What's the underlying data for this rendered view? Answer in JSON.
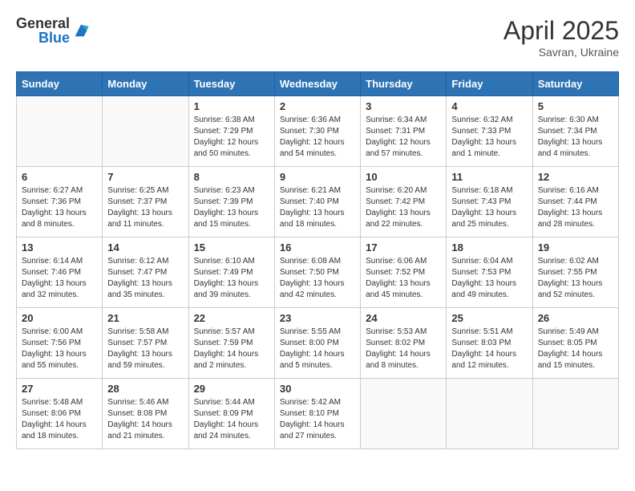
{
  "logo": {
    "general": "General",
    "blue": "Blue"
  },
  "title": "April 2025",
  "subtitle": "Savran, Ukraine",
  "days_of_week": [
    "Sunday",
    "Monday",
    "Tuesday",
    "Wednesday",
    "Thursday",
    "Friday",
    "Saturday"
  ],
  "weeks": [
    [
      {
        "day": "",
        "info": ""
      },
      {
        "day": "",
        "info": ""
      },
      {
        "day": "1",
        "info": "Sunrise: 6:38 AM\nSunset: 7:29 PM\nDaylight: 12 hours and 50 minutes."
      },
      {
        "day": "2",
        "info": "Sunrise: 6:36 AM\nSunset: 7:30 PM\nDaylight: 12 hours and 54 minutes."
      },
      {
        "day": "3",
        "info": "Sunrise: 6:34 AM\nSunset: 7:31 PM\nDaylight: 12 hours and 57 minutes."
      },
      {
        "day": "4",
        "info": "Sunrise: 6:32 AM\nSunset: 7:33 PM\nDaylight: 13 hours and 1 minute."
      },
      {
        "day": "5",
        "info": "Sunrise: 6:30 AM\nSunset: 7:34 PM\nDaylight: 13 hours and 4 minutes."
      }
    ],
    [
      {
        "day": "6",
        "info": "Sunrise: 6:27 AM\nSunset: 7:36 PM\nDaylight: 13 hours and 8 minutes."
      },
      {
        "day": "7",
        "info": "Sunrise: 6:25 AM\nSunset: 7:37 PM\nDaylight: 13 hours and 11 minutes."
      },
      {
        "day": "8",
        "info": "Sunrise: 6:23 AM\nSunset: 7:39 PM\nDaylight: 13 hours and 15 minutes."
      },
      {
        "day": "9",
        "info": "Sunrise: 6:21 AM\nSunset: 7:40 PM\nDaylight: 13 hours and 18 minutes."
      },
      {
        "day": "10",
        "info": "Sunrise: 6:20 AM\nSunset: 7:42 PM\nDaylight: 13 hours and 22 minutes."
      },
      {
        "day": "11",
        "info": "Sunrise: 6:18 AM\nSunset: 7:43 PM\nDaylight: 13 hours and 25 minutes."
      },
      {
        "day": "12",
        "info": "Sunrise: 6:16 AM\nSunset: 7:44 PM\nDaylight: 13 hours and 28 minutes."
      }
    ],
    [
      {
        "day": "13",
        "info": "Sunrise: 6:14 AM\nSunset: 7:46 PM\nDaylight: 13 hours and 32 minutes."
      },
      {
        "day": "14",
        "info": "Sunrise: 6:12 AM\nSunset: 7:47 PM\nDaylight: 13 hours and 35 minutes."
      },
      {
        "day": "15",
        "info": "Sunrise: 6:10 AM\nSunset: 7:49 PM\nDaylight: 13 hours and 39 minutes."
      },
      {
        "day": "16",
        "info": "Sunrise: 6:08 AM\nSunset: 7:50 PM\nDaylight: 13 hours and 42 minutes."
      },
      {
        "day": "17",
        "info": "Sunrise: 6:06 AM\nSunset: 7:52 PM\nDaylight: 13 hours and 45 minutes."
      },
      {
        "day": "18",
        "info": "Sunrise: 6:04 AM\nSunset: 7:53 PM\nDaylight: 13 hours and 49 minutes."
      },
      {
        "day": "19",
        "info": "Sunrise: 6:02 AM\nSunset: 7:55 PM\nDaylight: 13 hours and 52 minutes."
      }
    ],
    [
      {
        "day": "20",
        "info": "Sunrise: 6:00 AM\nSunset: 7:56 PM\nDaylight: 13 hours and 55 minutes."
      },
      {
        "day": "21",
        "info": "Sunrise: 5:58 AM\nSunset: 7:57 PM\nDaylight: 13 hours and 59 minutes."
      },
      {
        "day": "22",
        "info": "Sunrise: 5:57 AM\nSunset: 7:59 PM\nDaylight: 14 hours and 2 minutes."
      },
      {
        "day": "23",
        "info": "Sunrise: 5:55 AM\nSunset: 8:00 PM\nDaylight: 14 hours and 5 minutes."
      },
      {
        "day": "24",
        "info": "Sunrise: 5:53 AM\nSunset: 8:02 PM\nDaylight: 14 hours and 8 minutes."
      },
      {
        "day": "25",
        "info": "Sunrise: 5:51 AM\nSunset: 8:03 PM\nDaylight: 14 hours and 12 minutes."
      },
      {
        "day": "26",
        "info": "Sunrise: 5:49 AM\nSunset: 8:05 PM\nDaylight: 14 hours and 15 minutes."
      }
    ],
    [
      {
        "day": "27",
        "info": "Sunrise: 5:48 AM\nSunset: 8:06 PM\nDaylight: 14 hours and 18 minutes."
      },
      {
        "day": "28",
        "info": "Sunrise: 5:46 AM\nSunset: 8:08 PM\nDaylight: 14 hours and 21 minutes."
      },
      {
        "day": "29",
        "info": "Sunrise: 5:44 AM\nSunset: 8:09 PM\nDaylight: 14 hours and 24 minutes."
      },
      {
        "day": "30",
        "info": "Sunrise: 5:42 AM\nSunset: 8:10 PM\nDaylight: 14 hours and 27 minutes."
      },
      {
        "day": "",
        "info": ""
      },
      {
        "day": "",
        "info": ""
      },
      {
        "day": "",
        "info": ""
      }
    ]
  ]
}
